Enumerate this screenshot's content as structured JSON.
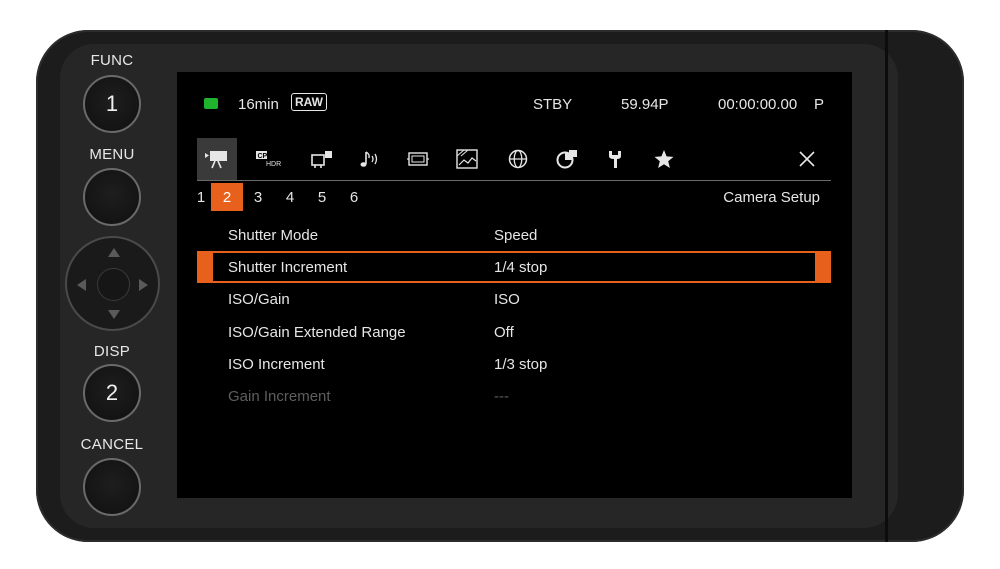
{
  "buttons": {
    "func_label": "FUNC",
    "func_key": "1",
    "menu_label": "MENU",
    "disp_label": "DISP",
    "disp_key": "2",
    "cancel_label": "CANCEL"
  },
  "status": {
    "media_icon": "media-card-icon",
    "remaining": "16min",
    "format_badge": "RAW",
    "mode": "STBY",
    "frame_rate": "59.94P",
    "timecode": "00:00:00.00",
    "tc_mode": "P"
  },
  "tabs": [
    {
      "icon": "camera-icon",
      "glyph": "▸▀"
    },
    {
      "icon": "cp-hdr-icon",
      "glyph": "CP"
    },
    {
      "icon": "video-settings-icon",
      "glyph": "⊡"
    },
    {
      "icon": "audio-icon",
      "glyph": "♪⁾"
    },
    {
      "icon": "monitor-icon",
      "glyph": "⊞"
    },
    {
      "icon": "recording-icon",
      "glyph": "▨"
    },
    {
      "icon": "network-icon",
      "glyph": "⊕"
    },
    {
      "icon": "system-icon",
      "glyph": "◕"
    },
    {
      "icon": "maintenance-icon",
      "glyph": "Ƴ"
    },
    {
      "icon": "my-menu-icon",
      "glyph": "★"
    }
  ],
  "close_glyph": "✕",
  "pages": [
    "1",
    "2",
    "3",
    "4",
    "5",
    "6"
  ],
  "active_page": "2",
  "section_title": "Camera Setup",
  "rows": [
    {
      "label": "Shutter Mode",
      "value": "Speed"
    },
    {
      "label": "Shutter Increment",
      "value": "1/4 stop"
    },
    {
      "label": "ISO/Gain",
      "value": "ISO"
    },
    {
      "label": "ISO/Gain Extended Range",
      "value": "Off"
    },
    {
      "label": "ISO Increment",
      "value": "1/3 stop"
    },
    {
      "label": "Gain Increment",
      "value": "---"
    }
  ],
  "colors": {
    "accent": "#e8611c",
    "screen_bg": "#000000",
    "media_green": "#1fb32e"
  }
}
